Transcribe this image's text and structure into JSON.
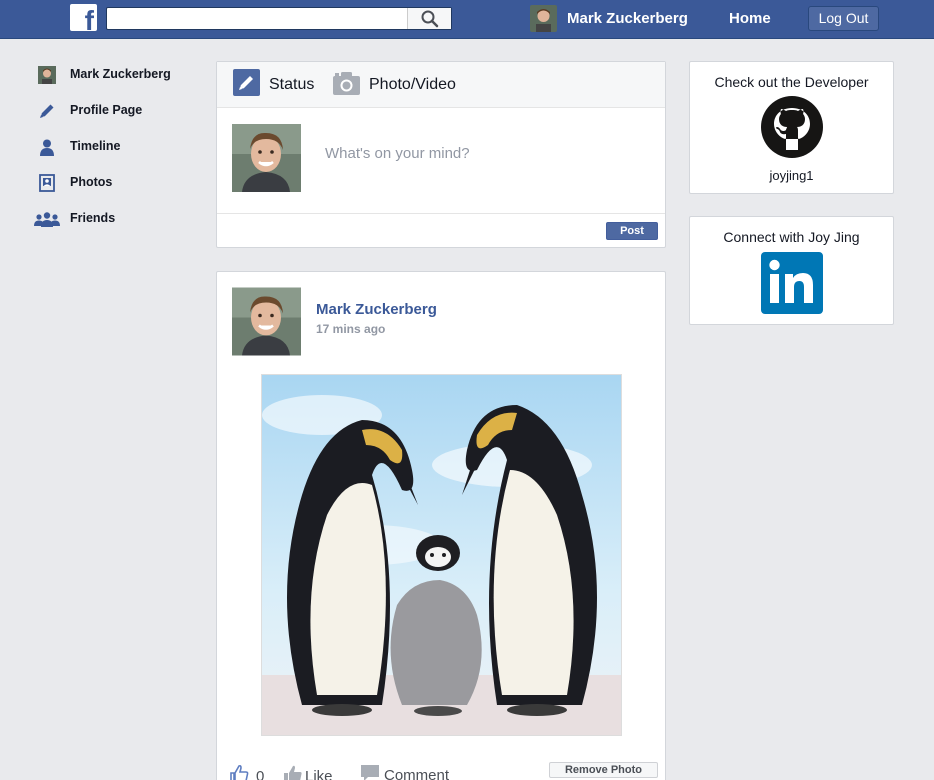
{
  "header": {
    "user_name": "Mark Zuckerberg",
    "home_label": "Home",
    "logout_label": "Log Out",
    "search_placeholder": ""
  },
  "sidebar": {
    "items": [
      {
        "label": "Mark Zuckerberg",
        "icon": "avatar"
      },
      {
        "label": "Profile Page",
        "icon": "pencil-icon"
      },
      {
        "label": "Timeline",
        "icon": "person-icon"
      },
      {
        "label": "Photos",
        "icon": "photo-icon"
      },
      {
        "label": "Friends",
        "icon": "friends-icon"
      }
    ]
  },
  "composer": {
    "tabs": [
      {
        "label": "Status",
        "icon": "pencil-icon"
      },
      {
        "label": "Photo/Video",
        "icon": "camera-icon"
      }
    ],
    "placeholder": "What's on your mind?",
    "post_label": "Post"
  },
  "story": {
    "author": "Mark Zuckerberg",
    "time": "17 mins ago",
    "like_count": "0",
    "like_label": "Like",
    "comment_label": "Comment",
    "remove_label": "Remove Photo"
  },
  "developer": {
    "title": "Check out the Developer",
    "username": "joyjing1",
    "icon": "github-icon"
  },
  "connect": {
    "title": "Connect with Joy Jing",
    "icon": "linkedin-icon"
  },
  "colors": {
    "brand": "#3b5998",
    "background": "#e9eaed",
    "button": "#4e69a2"
  }
}
